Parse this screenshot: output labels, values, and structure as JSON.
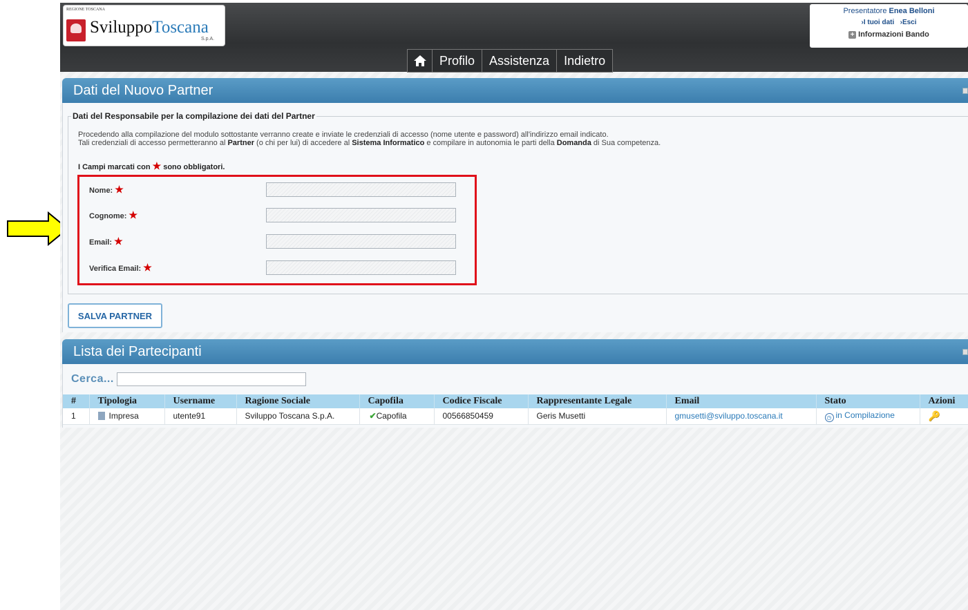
{
  "header": {
    "logo_small": "REGIONE TOSCANA",
    "logo_name_a": "Sviluppo",
    "logo_name_b": "Toscana",
    "logo_spa": "S.p.A.",
    "user_prefix": "Presentatore ",
    "user_name": "Enea Belloni",
    "link_my_data": "›I tuoi dati",
    "link_exit": "›Esci",
    "link_info": "Informazioni Bando"
  },
  "nav": {
    "items": [
      "Profilo",
      "Assistenza",
      "Indietro"
    ]
  },
  "panel1": {
    "title": "Dati del Nuovo Partner",
    "legend": "Dati del Responsabile per la compilazione dei dati del Partner",
    "intro_line1": "Procedendo alla compilazione del modulo sottostante verranno create e inviate le credenziali di accesso (nome utente e password) all'indirizzo email indicato.",
    "intro_line2_a": "Tali credenziali di accesso permetteranno al ",
    "intro_line2_b": "Partner",
    "intro_line2_c": " (o chi per lui) di accedere al ",
    "intro_line2_d": "Sistema Informatico",
    "intro_line2_e": " e compilare in autonomia le parti della ",
    "intro_line2_f": "Domanda",
    "intro_line2_g": " di Sua competenza.",
    "req_a": "I Campi marcati con ",
    "req_b": " sono obbligatori.",
    "fields": [
      {
        "label": "Nome:",
        "value": ""
      },
      {
        "label": "Cognome:",
        "value": ""
      },
      {
        "label": "Email:",
        "value": ""
      },
      {
        "label": "Verifica Email:",
        "value": ""
      }
    ],
    "save_label": "SALVA PARTNER"
  },
  "panel2": {
    "title": "Lista dei Partecipanti",
    "search_label": "Cerca...",
    "search_value": "",
    "columns": [
      "#",
      "Tipologia",
      "Username",
      "Ragione Sociale",
      "Capofila",
      "Codice Fiscale",
      "Rappresentante Legale",
      "Email",
      "Stato",
      "Azioni"
    ],
    "rows": [
      {
        "num": "1",
        "tipologia": "Impresa",
        "username": "utente91",
        "ragione": "Sviluppo Toscana S.p.A.",
        "capofila": "Capofila",
        "cf": "00566850459",
        "rappresentante": "Geris Musetti",
        "email": "gmusetti@sviluppo.toscana.it",
        "stato": "in Compilazione"
      }
    ]
  },
  "colors": {
    "accent": "#3c7eae",
    "highlight_box": "#e0101a",
    "arrow": "#ffff00"
  }
}
